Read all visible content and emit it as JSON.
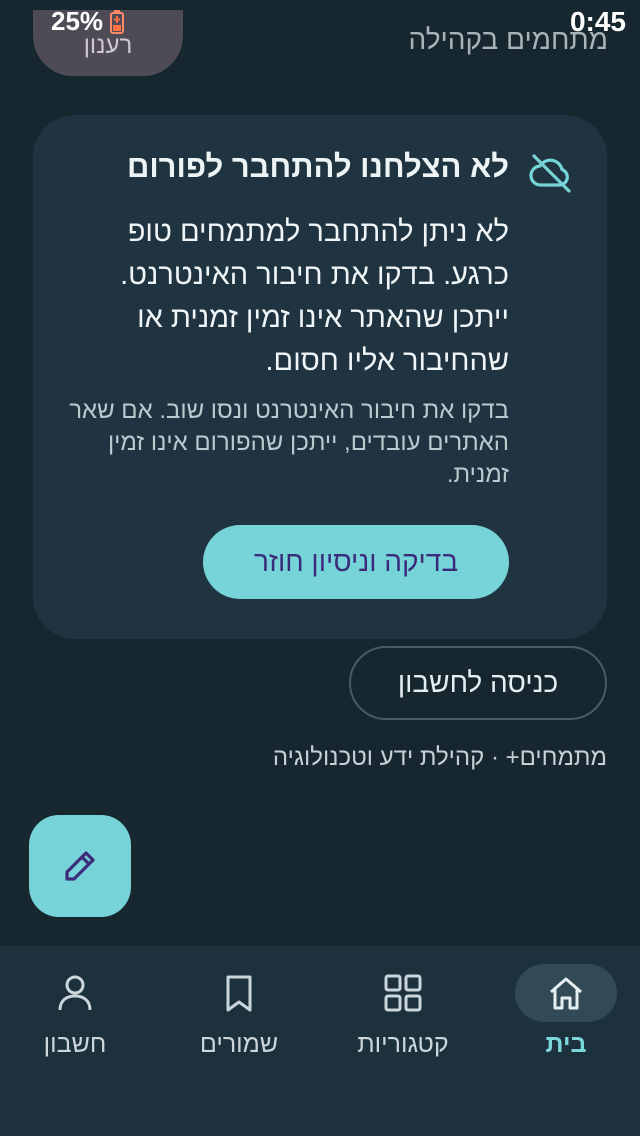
{
  "status_bar": {
    "battery": "25%",
    "time": "0:45"
  },
  "top_remnant": {
    "pill_label": "רענון",
    "text": "מתחמים בקהילה"
  },
  "error_card": {
    "title": "לא הצלחנו להתחבר לפורום",
    "body": "לא ניתן להתחבר למתמחים טופ כרגע. בדקו את חיבור האינטרנט. ייתכן שהאתר אינו זמין זמנית או שהחיבור אליו חסום.",
    "hint": "בדקו את חיבור האינטרנט ונסו שוב. אם שאר האתרים עובדים, ייתכן שהפורום אינו זמין זמנית.",
    "retry_label": "בדיקה וניסיון חוזר"
  },
  "signin_label": "כניסה לחשבון",
  "footer_text": "מתמחים+ · קהילת ידע וטכנולוגיה",
  "fab": {
    "icon": "pencil-icon"
  },
  "bottom_nav": [
    {
      "label": "בית",
      "icon": "home-icon",
      "active": true
    },
    {
      "label": "קטגוריות",
      "icon": "grid-icon",
      "active": false
    },
    {
      "label": "שמורים",
      "icon": "bookmark-icon",
      "active": false
    },
    {
      "label": "חשבון",
      "icon": "person-icon",
      "active": false
    }
  ],
  "colors": {
    "background": "#172730",
    "card": "#1f3440",
    "accent": "#76d4d8",
    "accent_text": "#3a2c7a",
    "nav_bg": "#1d313c"
  }
}
